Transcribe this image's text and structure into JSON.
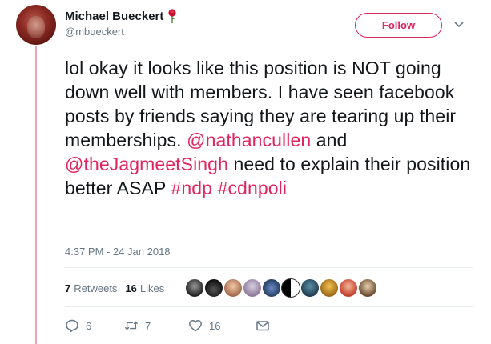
{
  "author": {
    "display_name": "Michael Bueckert",
    "handle": "@mbueckert"
  },
  "follow_label": "Follow",
  "tweet": {
    "segments": [
      {
        "text": "lol okay it looks like this position is NOT going down well with members. I have seen facebook posts by friends saying they are tearing up their memberships. ",
        "type": "text"
      },
      {
        "text": "@nathancullen",
        "type": "mention"
      },
      {
        "text": " and ",
        "type": "text"
      },
      {
        "text": "@theJagmeetSingh",
        "type": "mention"
      },
      {
        "text": " need to explain their position better ASAP ",
        "type": "text"
      },
      {
        "text": "#ndp",
        "type": "hashtag"
      },
      {
        "text": " ",
        "type": "text"
      },
      {
        "text": "#cdnpoli",
        "type": "hashtag"
      }
    ],
    "timestamp": "4:37 PM - 24 Jan 2018"
  },
  "stats": {
    "retweets_count": "7",
    "retweets_label": "Retweets",
    "likes_count": "16",
    "likes_label": "Likes"
  },
  "actions": {
    "reply_count": "6",
    "retweet_count": "7",
    "like_count": "16"
  },
  "colors": {
    "accent": "#e0245e",
    "thread_line": "#e9a9b4",
    "secondary_text": "#657786",
    "divider": "#e6ecf0"
  },
  "likers": [
    "liker-1",
    "liker-2",
    "liker-3",
    "liker-4",
    "liker-5",
    "liker-6",
    "liker-7",
    "liker-8",
    "liker-9",
    "liker-10"
  ]
}
